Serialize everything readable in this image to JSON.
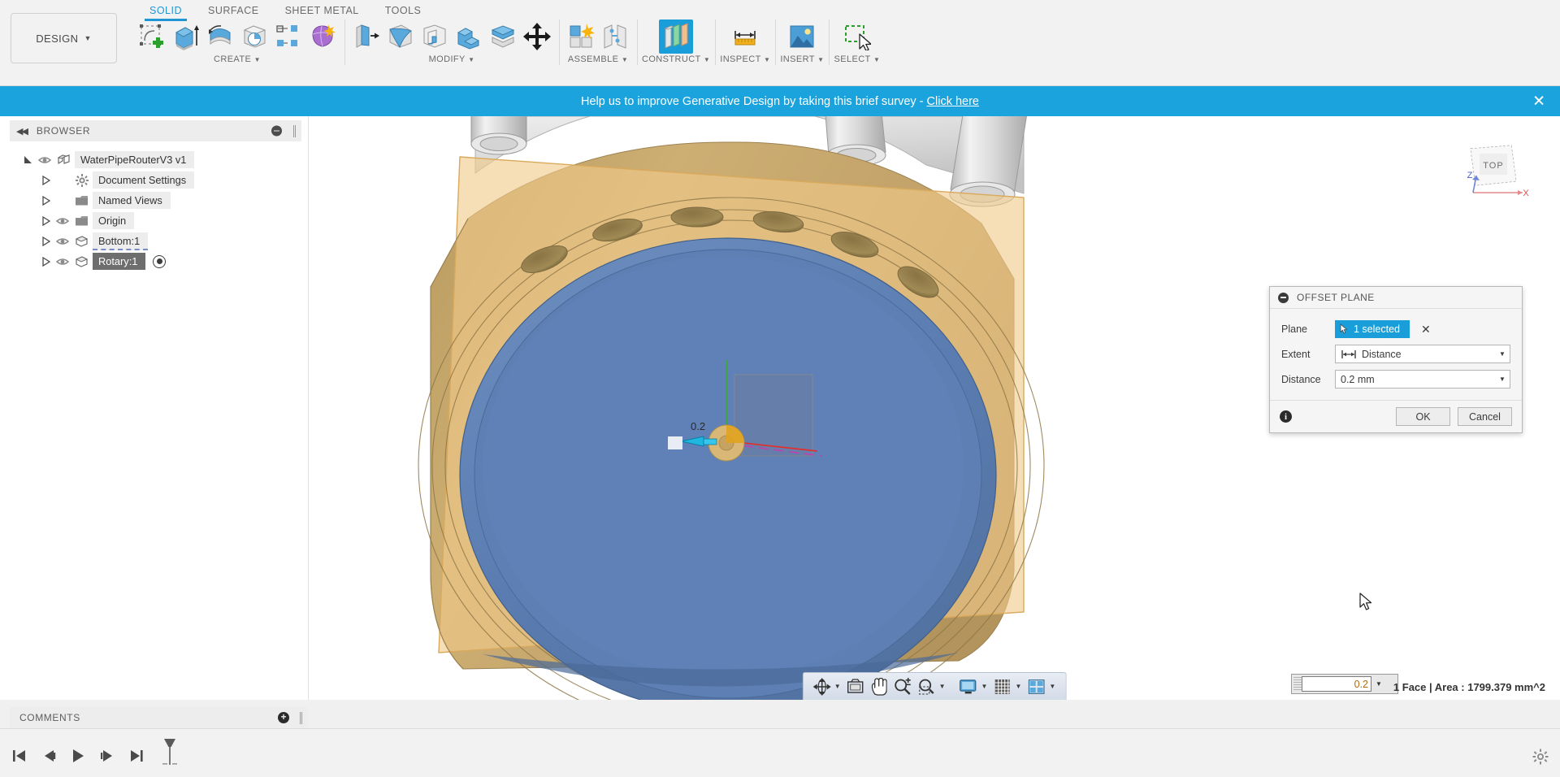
{
  "app": {
    "workspace_label": "DESIGN",
    "status_text": "1 Face | Area : 1799.379 mm^2"
  },
  "tabs": [
    {
      "label": "SOLID",
      "active": true
    },
    {
      "label": "SURFACE",
      "active": false
    },
    {
      "label": "SHEET METAL",
      "active": false
    },
    {
      "label": "TOOLS",
      "active": false
    }
  ],
  "ribbon_groups": [
    {
      "name": "CREATE",
      "tools": [
        {
          "name": "create-sketch-icon",
          "label": "Create Sketch"
        },
        {
          "name": "extrude-icon",
          "label": "Extrude"
        },
        {
          "name": "revolve-icon",
          "label": "Revolve"
        },
        {
          "name": "hole-icon",
          "label": "Hole"
        },
        {
          "name": "rib-icon",
          "label": "Rib"
        },
        {
          "name": "form-icon",
          "label": "Create Form"
        }
      ]
    },
    {
      "name": "MODIFY",
      "tools": [
        {
          "name": "press-pull-icon",
          "label": "Press Pull"
        },
        {
          "name": "fillet-icon",
          "label": "Fillet"
        },
        {
          "name": "shell-icon",
          "label": "Shell"
        },
        {
          "name": "combine-icon",
          "label": "Combine"
        },
        {
          "name": "split-face-icon",
          "label": "Split Face"
        },
        {
          "name": "move-copy-icon",
          "label": "Move/Copy"
        }
      ]
    },
    {
      "name": "ASSEMBLE",
      "tools": [
        {
          "name": "new-component-icon",
          "label": "New Component"
        },
        {
          "name": "joint-icon",
          "label": "Joint"
        }
      ]
    },
    {
      "name": "CONSTRUCT",
      "tools": [
        {
          "name": "offset-plane-icon",
          "label": "Offset Plane",
          "active": true
        }
      ]
    },
    {
      "name": "INSPECT",
      "tools": [
        {
          "name": "measure-icon",
          "label": "Measure"
        }
      ]
    },
    {
      "name": "INSERT",
      "tools": [
        {
          "name": "insert-image-icon",
          "label": "Insert Image"
        }
      ]
    },
    {
      "name": "SELECT",
      "tools": [
        {
          "name": "select-icon",
          "label": "Select"
        }
      ]
    }
  ],
  "banner": {
    "message": "Help us to improve Generative Design by taking this brief survey - ",
    "link": "Click here",
    "close": "✕"
  },
  "browser": {
    "title": "BROWSER",
    "items": [
      {
        "label": "WaterPipeRouterV3 v1",
        "indent": 0,
        "expanded": true,
        "eye": true,
        "icon": "component-icon",
        "selected": false,
        "dashed": false,
        "radio": false
      },
      {
        "label": "Document Settings",
        "indent": 1,
        "expanded": false,
        "eye": false,
        "icon": "gear-icon",
        "selected": false,
        "dashed": false,
        "radio": false
      },
      {
        "label": "Named Views",
        "indent": 1,
        "expanded": false,
        "eye": false,
        "icon": "folder-icon",
        "selected": false,
        "dashed": false,
        "radio": false
      },
      {
        "label": "Origin",
        "indent": 1,
        "expanded": false,
        "eye": true,
        "icon": "folder-icon",
        "selected": false,
        "dashed": false,
        "radio": false
      },
      {
        "label": "Bottom:1",
        "indent": 1,
        "expanded": false,
        "eye": true,
        "icon": "body-icon",
        "selected": false,
        "dashed": true,
        "radio": false
      },
      {
        "label": "Rotary:1",
        "indent": 1,
        "expanded": false,
        "eye": true,
        "icon": "body-icon",
        "selected": true,
        "dashed": false,
        "radio": true
      }
    ]
  },
  "comments": {
    "title": "COMMENTS",
    "add_label": "+"
  },
  "dialog": {
    "title": "OFFSET PLANE",
    "plane_label": "Plane",
    "plane_value": "1 selected",
    "plane_clear": "✕",
    "extent_label": "Extent",
    "extent_value": "Distance",
    "distance_label": "Distance",
    "distance_value": "0.2 mm",
    "ok_label": "OK",
    "cancel_label": "Cancel"
  },
  "inline_input": {
    "value": "0.2"
  },
  "viewcube": {
    "face_label": "TOP",
    "axis_x": "X",
    "axis_z": "Z"
  },
  "navbar": {
    "buttons": [
      {
        "name": "orbit-icon",
        "caret": true
      },
      {
        "name": "look-at-icon",
        "caret": false
      },
      {
        "name": "pan-icon",
        "caret": false
      },
      {
        "name": "zoom-icon",
        "caret": false
      },
      {
        "name": "zoom-window-icon",
        "caret": true
      },
      {
        "name": "display-settings-icon",
        "caret": true
      },
      {
        "name": "grid-snaps-icon",
        "caret": true
      },
      {
        "name": "viewports-icon",
        "caret": true
      }
    ]
  },
  "timeline": {
    "buttons": [
      {
        "name": "go-to-beginning-icon"
      },
      {
        "name": "step-back-icon"
      },
      {
        "name": "play-icon"
      },
      {
        "name": "step-forward-icon"
      },
      {
        "name": "go-to-end-icon"
      }
    ],
    "marker_name": "timeline-end-marker"
  },
  "colors": {
    "accent": "#1a9ed9",
    "banner": "#1aa3dd",
    "tab_active": "#2196d4",
    "body_tan": "#c9a96b",
    "body_blue": "#5c7fb5",
    "panel_bg": "#f2f2f2"
  }
}
